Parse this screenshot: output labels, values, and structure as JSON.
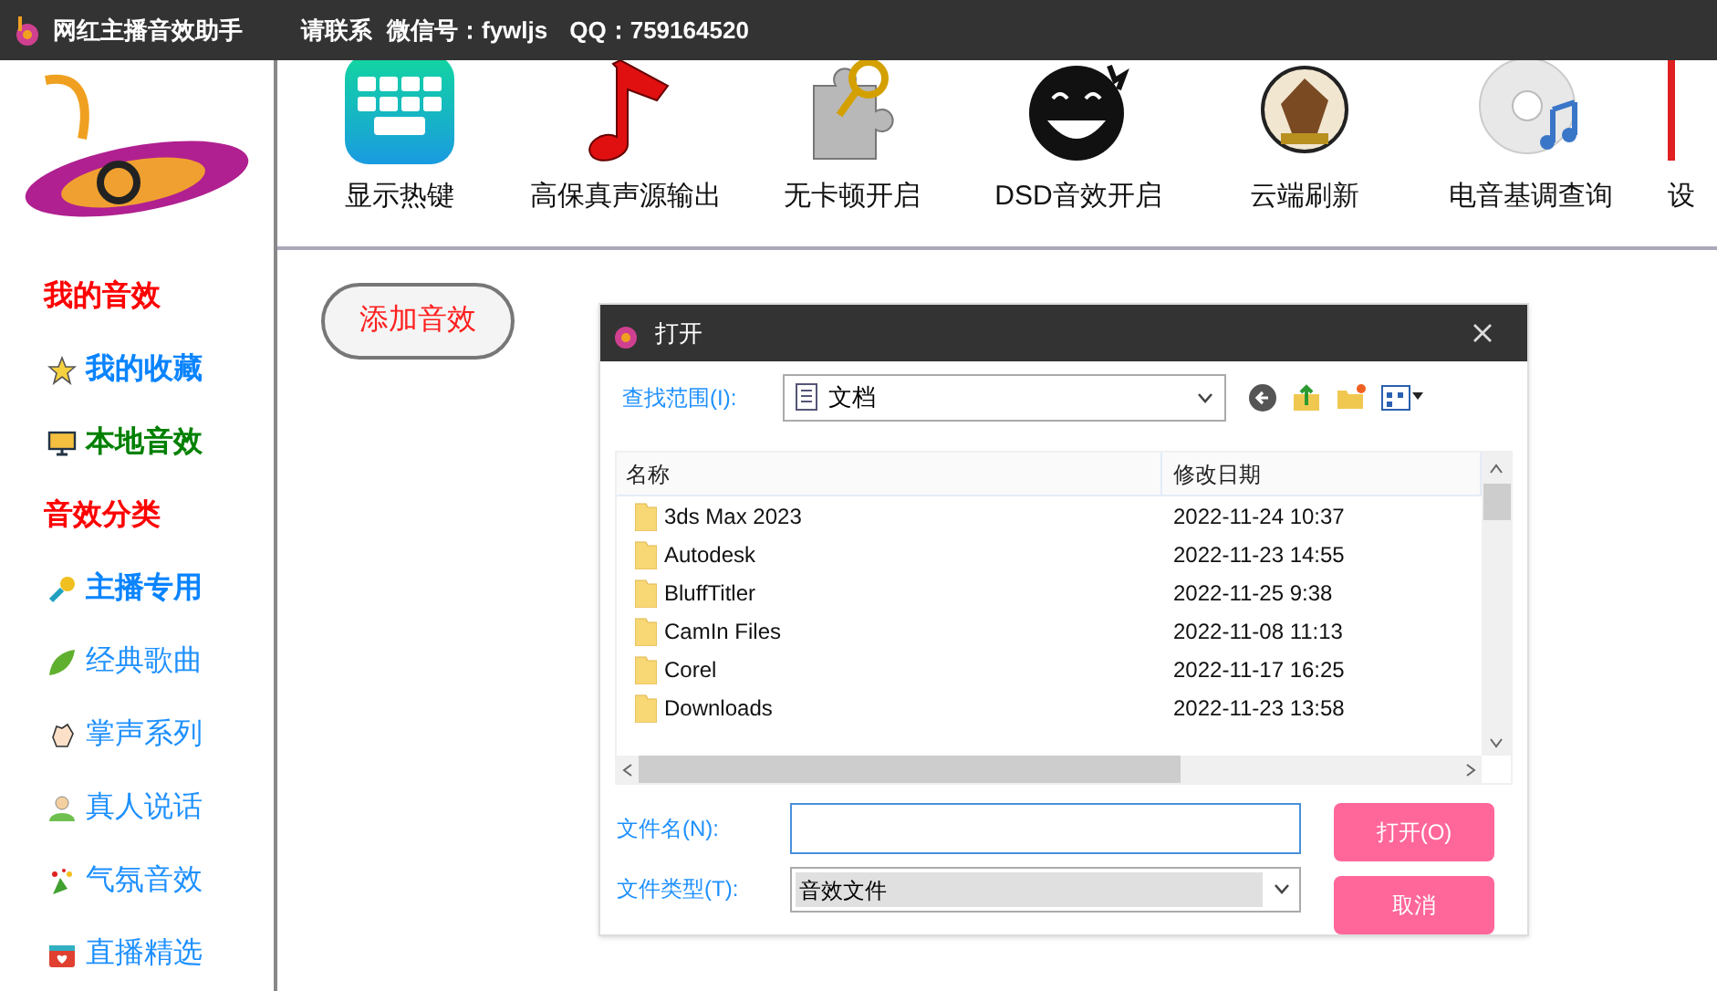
{
  "title_bar": {
    "app_name": "网红主播音效助手",
    "contact": "请联系",
    "wechat": "微信号：fywljs",
    "qq": "QQ：759164520"
  },
  "toolbar": [
    {
      "label": "显示热键",
      "kind": "keyboard"
    },
    {
      "label": "高保真声源输出",
      "kind": "note"
    },
    {
      "label": "无卡顿开启",
      "kind": "puzzle"
    },
    {
      "label": "DSD音效开启",
      "kind": "face"
    },
    {
      "label": "云端刷新",
      "kind": "badge"
    },
    {
      "label": "电音基调查询",
      "kind": "disc"
    },
    {
      "label": "设",
      "kind": "cut"
    }
  ],
  "sidebar": {
    "items": [
      {
        "label": "我的音效",
        "kind": "heading",
        "color": "#ff0000"
      },
      {
        "label": "我的收藏",
        "kind": "star",
        "color": "#0a84ff",
        "bold": true
      },
      {
        "label": "本地音效",
        "kind": "monitor",
        "color": "#008000",
        "bold": true
      },
      {
        "label": "音效分类",
        "kind": "heading",
        "color": "#ff0000"
      },
      {
        "label": "主播专用",
        "kind": "mic",
        "color": "#0a84ff",
        "bold": true
      },
      {
        "label": "经典歌曲",
        "kind": "leaf",
        "color": "#1e90ff",
        "bold": false
      },
      {
        "label": "掌声系列",
        "kind": "hands",
        "color": "#1e90ff",
        "bold": false
      },
      {
        "label": "真人说话",
        "kind": "person",
        "color": "#1e90ff",
        "bold": false
      },
      {
        "label": "气氛音效",
        "kind": "confetti",
        "color": "#1e90ff",
        "bold": false
      },
      {
        "label": "直播精选",
        "kind": "gift",
        "color": "#1e90ff",
        "bold": false
      }
    ]
  },
  "add_button": "添加音效",
  "dialog": {
    "title": "打开",
    "look_in_label": "查找范围(I):",
    "look_in_value": "文档",
    "columns": [
      "名称",
      "修改日期"
    ],
    "rows": [
      {
        "name": "3ds Max 2023",
        "date": "2022-11-24 10:37"
      },
      {
        "name": "Autodesk",
        "date": "2022-11-23 14:55"
      },
      {
        "name": "BluffTitler",
        "date": "2022-11-25 9:38"
      },
      {
        "name": "CamIn Files",
        "date": "2022-11-08 11:13"
      },
      {
        "name": "Corel",
        "date": "2022-11-17 16:25"
      },
      {
        "name": "Downloads",
        "date": "2022-11-23 13:58"
      }
    ],
    "filename_label": "文件名(N):",
    "filetype_label": "文件类型(T):",
    "filetype_value": "音效文件",
    "open_button": "打开(O)",
    "cancel_button": "取消"
  }
}
